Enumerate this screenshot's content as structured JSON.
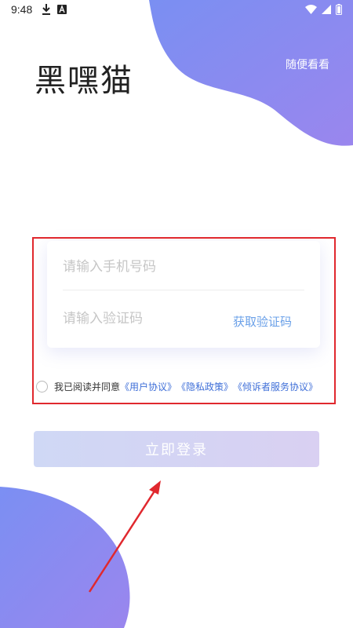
{
  "status_bar": {
    "time": "9:48",
    "download_icon": "download-icon",
    "notification_icon": "a-notification-icon",
    "wifi_icon": "wifi-icon",
    "signal_icon": "signal-icon",
    "battery_icon": "battery-icon"
  },
  "header": {
    "app_title": "黑嘿猫",
    "browse_label": "随便看看"
  },
  "form": {
    "phone_placeholder": "请输入手机号码",
    "code_placeholder": "请输入验证码",
    "get_code_label": "获取验证码"
  },
  "agreement": {
    "prefix": "我已阅读并同意",
    "links": [
      "《用户协议》",
      "《隐私政策》",
      "《倾诉者服务协议》"
    ]
  },
  "login_button_label": "立即登录",
  "colors": {
    "accent_gradient_start": "#7a8ff2",
    "accent_gradient_end": "#9a86ee",
    "link": "#3f6fd8",
    "annotation_red": "#e0282e"
  }
}
